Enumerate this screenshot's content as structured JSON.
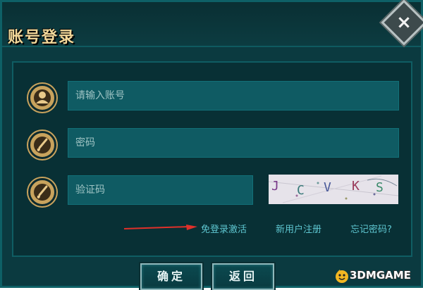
{
  "dialog": {
    "title": "账号登录",
    "close_label": "×"
  },
  "form": {
    "account_placeholder": "请输入账号",
    "password_placeholder": "密码",
    "captcha_placeholder": "验证码",
    "captcha_chars": [
      "J",
      "C",
      "V",
      "K",
      "S"
    ]
  },
  "links": {
    "free_login": "免登录激活",
    "register": "新用户注册",
    "forgot_password": "忘记密码?"
  },
  "buttons": {
    "confirm": "确定",
    "back": "返回"
  },
  "watermark": "3DMGAME",
  "colors": {
    "background": "#0b3a40",
    "field": "#0f5b63",
    "accent_gold": "#c8a35d",
    "link": "#5ec6d0",
    "arrow": "#e0302a"
  }
}
